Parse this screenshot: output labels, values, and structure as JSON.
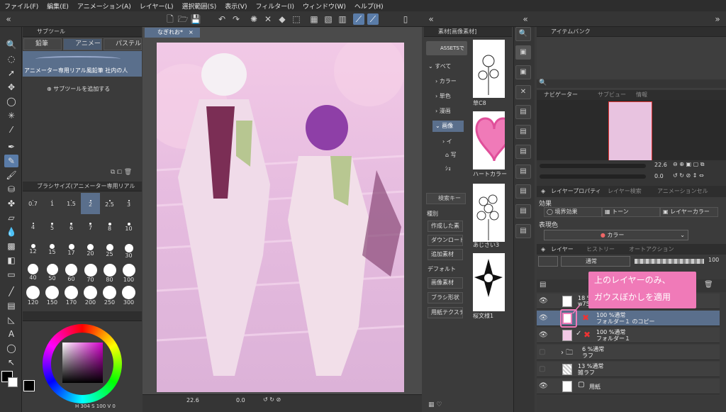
{
  "menu": [
    "ファイル(F)",
    "編集(E)",
    "アニメーション(A)",
    "レイヤー(L)",
    "選択範囲(S)",
    "表示(V)",
    "フィルター(I)",
    "ウィンドウ(W)",
    "ヘルプ(H)"
  ],
  "subtool": {
    "header": "サブツール",
    "tabs": [
      "鉛筆",
      "アニメー",
      "パステル"
    ],
    "selected_item": "アニメーター専用リアル風鉛筆 社内の人",
    "add_label": "サブツールを追加する"
  },
  "brush_size": {
    "header": "ブラシサイズ(アニメーター専用リアル",
    "sizes": [
      "0.7",
      "1",
      "1.5",
      "2",
      "2.5",
      "3",
      "4",
      "5",
      "6",
      "7",
      "8",
      "10",
      "12",
      "15",
      "17",
      "20",
      "25",
      "30",
      "40",
      "50",
      "60",
      "70",
      "80",
      "100",
      "120",
      "150",
      "170",
      "200",
      "250",
      "300"
    ],
    "selected": "2"
  },
  "color": {
    "h": "304",
    "s": "100",
    "v": "0"
  },
  "canvas_tab": "なぎれお*",
  "status": {
    "zoom": "22.6",
    "rotation": "0.0"
  },
  "materials": {
    "header": "素材[画像素材]",
    "assets_label": "ASSETSで",
    "tree": [
      "すべて",
      "カラー",
      "単色",
      "漫画",
      "画像",
      "イ",
      "写",
      "ｼｮ"
    ],
    "items": [
      {
        "label": "草C8"
      },
      {
        "label": "ハートカラー("
      },
      {
        "label": "あじさい3"
      },
      {
        "label": "桜文様1"
      }
    ],
    "search_placeholder": "検索キー",
    "type_label": "種別",
    "tags": [
      "作成した素",
      "ダウンロード",
      "追加素材",
      "デフォルト",
      "画像素材",
      "ブラシ形状",
      "用紙テクスチ"
    ]
  },
  "item_bank": "アイテムバンク",
  "navigator": {
    "tabs": [
      "ナビゲーター",
      "サブビュー",
      "情報"
    ],
    "zoom": "22.6",
    "rotation": "0.0"
  },
  "layer_property": {
    "tabs": [
      "レイヤープロパティ",
      "レイヤー検索",
      "アニメーションセル"
    ],
    "effect_label": "効果",
    "effects": [
      "境界効果",
      "トーン",
      "レイヤーカラー"
    ],
    "expression_label": "表現色",
    "expression_value": "カラー"
  },
  "layers": {
    "tabs": [
      "レイヤー",
      "ヒストリー",
      "オートアクション"
    ],
    "blend": "通常",
    "opacity": "100",
    "rows": [
      {
        "line1": "18 %通常",
        "line2": "w75"
      },
      {
        "line1": "100 %通常",
        "line2": "フォルダー１ のコピー"
      },
      {
        "line1": "100 %通常",
        "line2": "フォルダー１"
      },
      {
        "line1": "6 %通常",
        "line2": "ラフ"
      },
      {
        "line1": "13 %通常",
        "line2": "雑ラフ"
      },
      {
        "line1": "",
        "line2": "用紙"
      }
    ]
  },
  "annotation": [
    "上のレイヤーのみ、",
    "ガウスぼかしを適用"
  ],
  "colors": {
    "accent": "#5a7ca8",
    "callout": "#f07ab8"
  }
}
